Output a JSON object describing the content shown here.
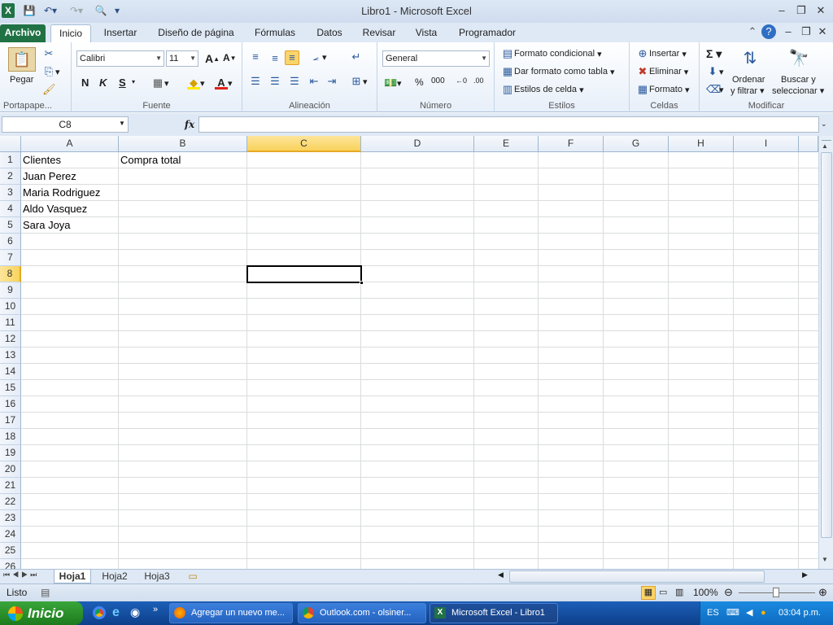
{
  "window": {
    "title": "Libro1  -  Microsoft Excel",
    "minimize_icon": "minimize-icon",
    "restore_icon": "restore-icon",
    "close_icon": "close-icon"
  },
  "tabs": [
    "Archivo",
    "Inicio",
    "Insertar",
    "Diseño de página",
    "Fórmulas",
    "Datos",
    "Revisar",
    "Vista",
    "Programador"
  ],
  "ribbon": {
    "clipboard": {
      "label": "Portapape...",
      "paste": "Pegar"
    },
    "font": {
      "label": "Fuente",
      "name": "Calibri",
      "size": "11",
      "bold": "N",
      "italic": "K",
      "underline": "S"
    },
    "alignment": {
      "label": "Alineación"
    },
    "number": {
      "label": "Número",
      "format": "General",
      "percent": "%",
      "thousands": "000"
    },
    "styles": {
      "label": "Estilos",
      "conditional": "Formato condicional",
      "as_table": "Dar formato como tabla",
      "cell_styles": "Estilos de celda"
    },
    "cells": {
      "label": "Celdas",
      "insert": "Insertar",
      "delete": "Eliminar",
      "format": "Formato"
    },
    "editing": {
      "label": "Modificar",
      "sort_1": "Ordenar",
      "sort_2": "y filtrar",
      "find_1": "Buscar y",
      "find_2": "seleccionar"
    }
  },
  "formula_bar": {
    "name_box": "C8",
    "fx": "fx",
    "value": ""
  },
  "sheet": {
    "columns": [
      "A",
      "B",
      "C",
      "D",
      "E",
      "F",
      "G",
      "H",
      "I"
    ],
    "selected_column": "C",
    "selected_row": 8,
    "rows": [
      1,
      2,
      3,
      4,
      5,
      6,
      7,
      8,
      9,
      10,
      11,
      12,
      13,
      14,
      15,
      16,
      17,
      18,
      19,
      20,
      21,
      22,
      23,
      24,
      25,
      26
    ],
    "cells": {
      "A1": "Clientes",
      "B1": "Compra total",
      "A2": "Juan Perez",
      "A3": "Maria Rodriguez",
      "A4": "Aldo Vasquez",
      "A5": "Sara Joya"
    }
  },
  "sheet_tabs": [
    "Hoja1",
    "Hoja2",
    "Hoja3"
  ],
  "active_sheet": "Hoja1",
  "status": {
    "mode": "Listo",
    "zoom": "100%"
  },
  "taskbar": {
    "start": "Inicio",
    "tasks": [
      "Agregar un nuevo me...",
      "Outlook.com - olsiner...",
      "Microsoft Excel - Libro1"
    ],
    "lang": "ES",
    "time": "03:04 p.m."
  }
}
